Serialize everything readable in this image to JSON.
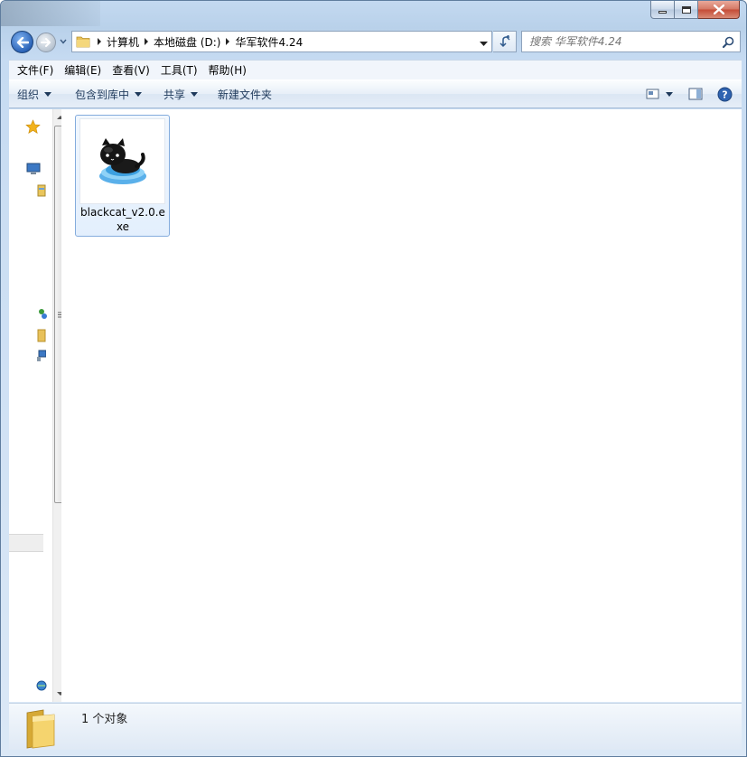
{
  "window": {
    "controls": {
      "minimize_icon": "minimize-icon",
      "maximize_icon": "maximize-icon",
      "close_icon": "close-icon"
    }
  },
  "navigation": {
    "breadcrumbs": [
      "计算机",
      "本地磁盘 (D:)",
      "华军软件4.24"
    ]
  },
  "search": {
    "placeholder": "搜索 华军软件4.24"
  },
  "menubar": {
    "items": [
      "文件(F)",
      "编辑(E)",
      "查看(V)",
      "工具(T)",
      "帮助(H)"
    ]
  },
  "toolbar": {
    "organize": "组织",
    "include_in_library": "包含到库中",
    "share": "共享",
    "new_folder": "新建文件夹"
  },
  "files": [
    {
      "name": "blackcat_v2.0.exe",
      "icon": "black-cat-icon"
    }
  ],
  "statusbar": {
    "count_text": "1 个对象"
  },
  "colors": {
    "accent": "#2c64b8",
    "selection_border": "#84acdd",
    "close_button": "#c44a35"
  }
}
